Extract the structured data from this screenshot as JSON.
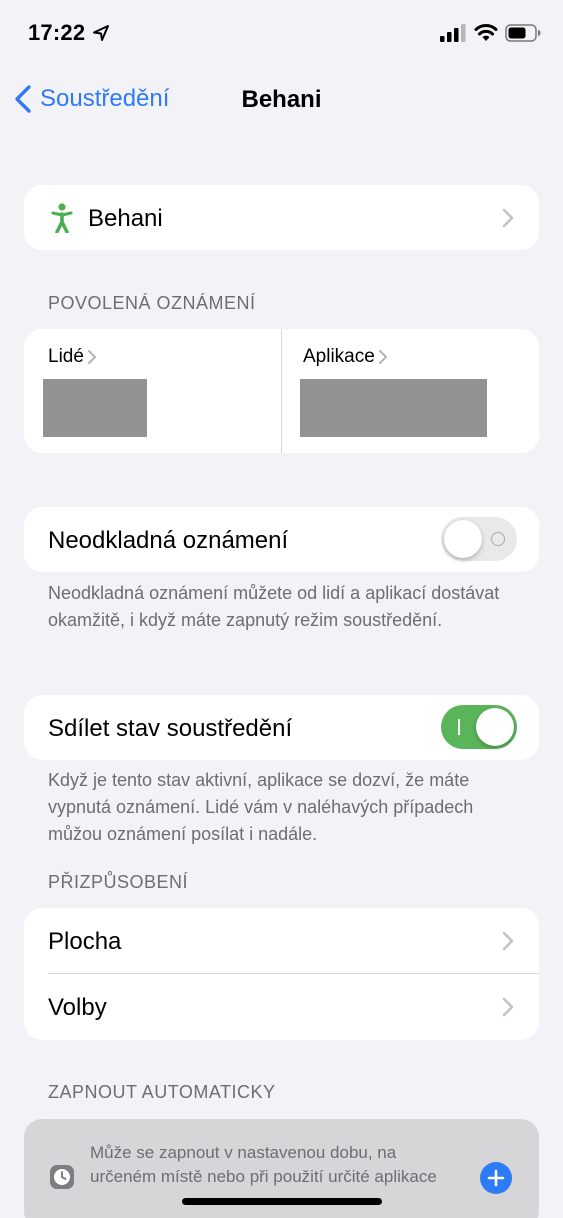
{
  "status_bar": {
    "time": "17:22"
  },
  "nav": {
    "back_label": "Soustředění",
    "title": "Behani"
  },
  "focus_row": {
    "label": "Behani"
  },
  "allowed_section": {
    "header": "POVOLENÁ OZNÁMENÍ",
    "people_label": "Lidé",
    "apps_label": "Aplikace"
  },
  "time_sensitive": {
    "label": "Neodkladná oznámení",
    "enabled": false,
    "footnote": "Neodkladná oznámení můžete od lidí a aplikací dostávat okamžitě, i když máte zapnutý režim soustředění."
  },
  "share_status": {
    "label": "Sdílet stav soustředění",
    "enabled": true,
    "footnote": "Když je tento stav aktivní, aplikace se dozví, že máte vypnutá oznámení. Lidé vám v naléhavých případech můžou oznámení posílat i nadále."
  },
  "customize_section": {
    "header": "PŘIZPŮSOBENÍ",
    "items": [
      {
        "label": "Plocha"
      },
      {
        "label": "Volby"
      }
    ]
  },
  "auto_section": {
    "header": "ZAPNOUT AUTOMATICKY",
    "hint": "Může se zapnout v nastavenou dobu, na určeném místě nebo při použití určité aplikace"
  },
  "colors": {
    "accent_blue": "#2f7bf5",
    "toggle_green": "#5ab55a",
    "focus_icon_green": "#4cb050",
    "background": "#f2f2f7"
  }
}
